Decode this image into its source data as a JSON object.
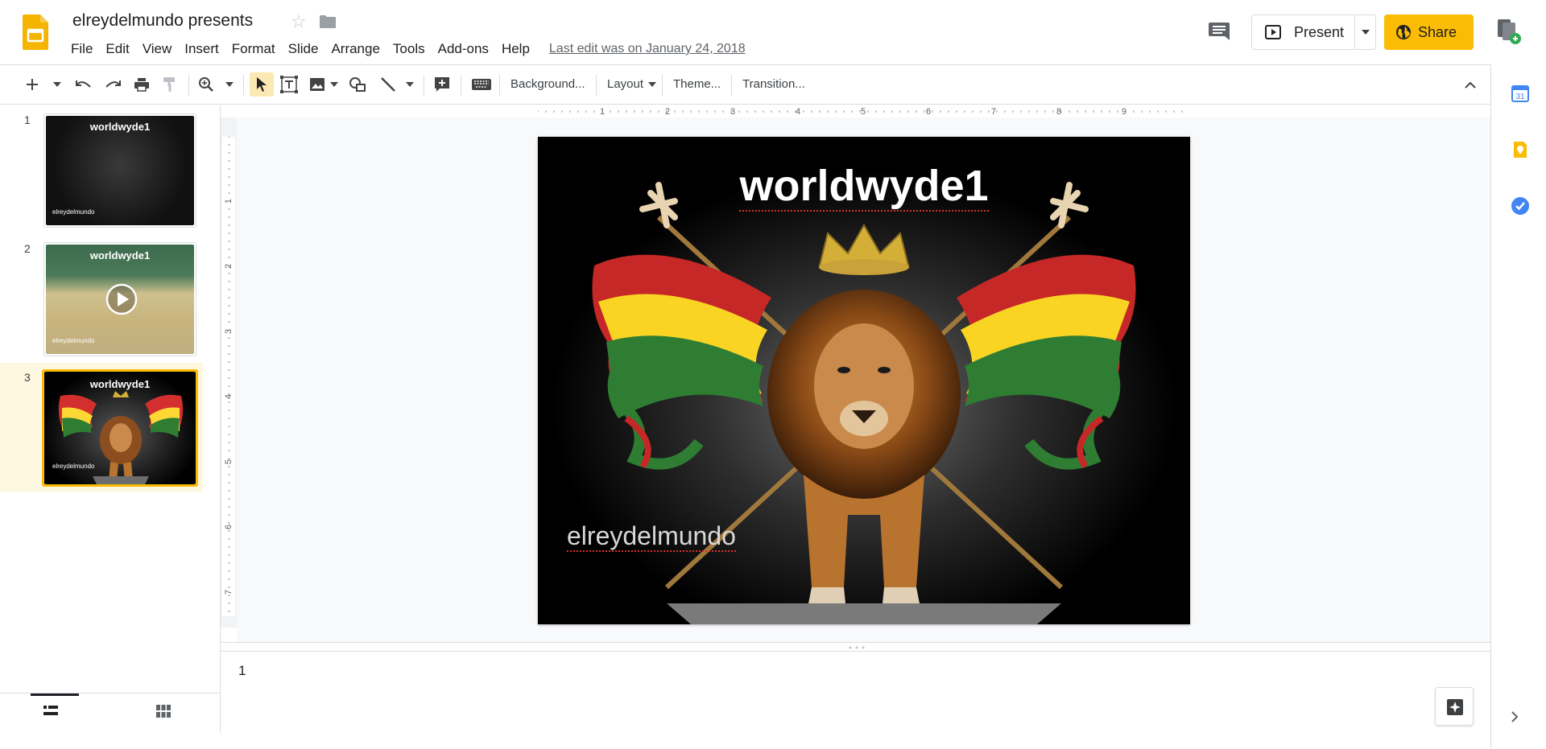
{
  "header": {
    "doc_title": "elreydelmundo presents",
    "menu": [
      "File",
      "Edit",
      "View",
      "Insert",
      "Format",
      "Slide",
      "Arrange",
      "Tools",
      "Add-ons",
      "Help"
    ],
    "last_edit": "Last edit was on January 24, 2018",
    "present_label": "Present",
    "share_label": "Share"
  },
  "toolbar": {
    "background_label": "Background...",
    "layout_label": "Layout",
    "theme_label": "Theme...",
    "transition_label": "Transition..."
  },
  "ruler": {
    "h_marks": [
      "1",
      "2",
      "3",
      "4",
      "5",
      "6",
      "7",
      "8",
      "9"
    ],
    "v_marks": [
      "1",
      "2",
      "3",
      "4",
      "5",
      "6",
      "7"
    ]
  },
  "filmstrip": {
    "slides": [
      {
        "number": "1",
        "title": "worldwyde1",
        "subtitle": "elreydelmundo"
      },
      {
        "number": "2",
        "title": "worldwyde1",
        "subtitle": "elreydelmundo"
      },
      {
        "number": "3",
        "title": "worldwyde1",
        "subtitle": "elreydelmundo"
      }
    ]
  },
  "slide": {
    "title": "worldwyde1",
    "subtitle": "elreydelmundo"
  },
  "notes": {
    "text": "1"
  },
  "colors": {
    "accent": "#fbbc04",
    "selected_bg": "#fef7e0",
    "canvas_bg": "#f8f9fa"
  }
}
